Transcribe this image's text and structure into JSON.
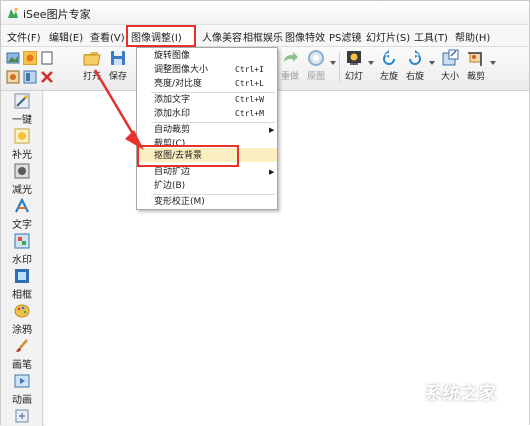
{
  "window": {
    "title": "iSee图片专家"
  },
  "menubar": {
    "items": [
      "文件(F)",
      "编辑(E)",
      "查看(V)",
      "图像调整(I)",
      "人像美容",
      "相框娱乐",
      "图像特效",
      "PS滤镜",
      "幻灯片(S)",
      "工具(T)",
      "帮助(H)"
    ]
  },
  "toolbar": {
    "open_label": "打开",
    "save_label": "保存",
    "redo_label": "重做",
    "original_label": "原图",
    "slideshow_label": "幻灯",
    "rotate_left_label": "左旋",
    "rotate_right_label": "右旋",
    "resize_label": "大小",
    "crop_label": "裁剪"
  },
  "sidebar": {
    "tools": [
      "一键",
      "补光",
      "减光",
      "文字",
      "水印",
      "相框",
      "涂鸦",
      "画笔",
      "动画"
    ]
  },
  "dropdown": {
    "items": [
      {
        "label": "旋转图像",
        "shortcut": "",
        "submenu": false
      },
      {
        "label": "调整图像大小",
        "shortcut": "Ctrl+I",
        "submenu": false
      },
      {
        "label": "亮度/对比度",
        "shortcut": "Ctrl+L",
        "submenu": false
      },
      {
        "label": "添加文字",
        "shortcut": "Ctrl+W",
        "submenu": false
      },
      {
        "label": "添加水印",
        "shortcut": "Ctrl+M",
        "submenu": false
      },
      {
        "label": "自动裁剪",
        "shortcut": "",
        "submenu": true
      },
      {
        "label": "裁剪(C)",
        "shortcut": "",
        "submenu": false
      },
      {
        "label": "抠图/去背景",
        "shortcut": "",
        "submenu": false,
        "highlighted": true
      },
      {
        "label": "自动扩边",
        "shortcut": "",
        "submenu": true
      },
      {
        "label": "扩边(B)",
        "shortcut": "",
        "submenu": false
      },
      {
        "label": "变形校正(M)",
        "shortcut": "",
        "submenu": false
      }
    ]
  },
  "watermark": {
    "title": "系统之家"
  },
  "colors": {
    "annotation_red": "#e5322d",
    "highlight": "#fbeec0",
    "arrow": "#e5322d"
  }
}
